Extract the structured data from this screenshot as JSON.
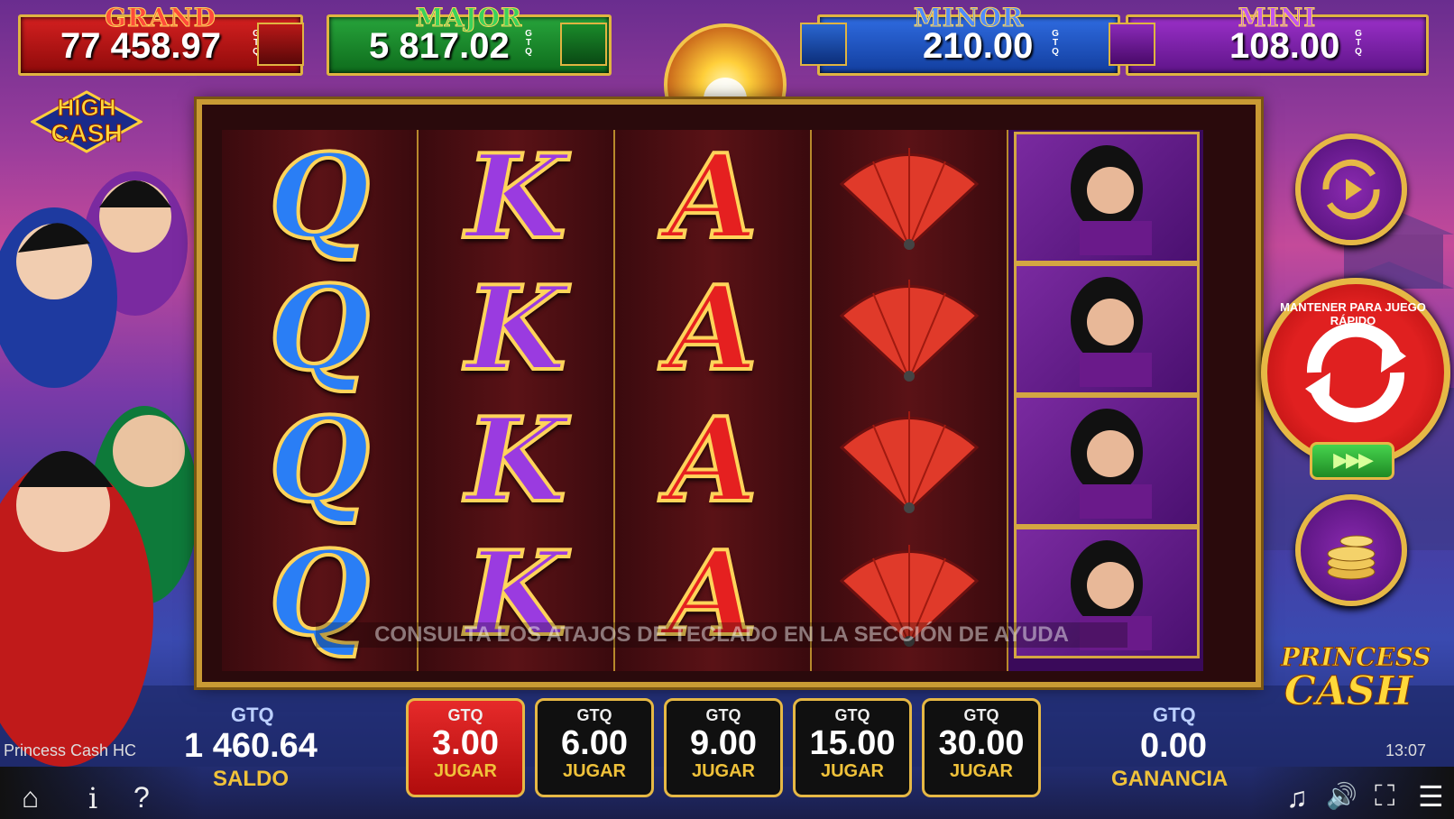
{
  "jackpots": {
    "grand": {
      "title": "GRAND",
      "value": "77 458.97",
      "currency": "GTQ"
    },
    "major": {
      "title": "MAJOR",
      "value": "5 817.02",
      "currency": "GTQ"
    },
    "minor": {
      "title": "MINOR",
      "value": "210.00",
      "currency": "GTQ"
    },
    "mini": {
      "title": "MINI",
      "value": "108.00",
      "currency": "GTQ"
    }
  },
  "logo_high_cash": [
    "HIGH",
    "CASH"
  ],
  "logo_princess_cash": [
    "PRINCESS",
    "CASH"
  ],
  "reels": [
    {
      "symbols": [
        "Q",
        "Q",
        "Q",
        "Q"
      ]
    },
    {
      "symbols": [
        "K",
        "K",
        "K",
        "K"
      ]
    },
    {
      "symbols": [
        "A",
        "A",
        "A",
        "A"
      ]
    },
    {
      "symbols": [
        "fan",
        "fan",
        "fan",
        "fan"
      ]
    },
    {
      "symbols": [
        "princess",
        "princess",
        "princess",
        "princess"
      ]
    }
  ],
  "hint": "CONSULTA LOS ATAJOS DE TECLADO EN LA SECCIÓN DE AYUDA",
  "spin_button_text": "MANTENER PARA JUEGO RÁPIDO",
  "turbo_label": "▶▶▶",
  "balance": {
    "currency": "GTQ",
    "value": "1 460.64",
    "label": "SALDO"
  },
  "win": {
    "currency": "GTQ",
    "value": "0.00",
    "label": "GANANCIA"
  },
  "bets": [
    {
      "currency": "GTQ",
      "value": "3.00",
      "label": "JUGAR",
      "active": true
    },
    {
      "currency": "GTQ",
      "value": "6.00",
      "label": "JUGAR",
      "active": false
    },
    {
      "currency": "GTQ",
      "value": "9.00",
      "label": "JUGAR",
      "active": false
    },
    {
      "currency": "GTQ",
      "value": "15.00",
      "label": "JUGAR",
      "active": false
    },
    {
      "currency": "GTQ",
      "value": "30.00",
      "label": "JUGAR",
      "active": false
    }
  ],
  "game_name": "Princess Cash HC",
  "clock": "13:07",
  "icons": {
    "home": "⌂",
    "info": "i",
    "help": "?",
    "music": "♫",
    "sound": "🔊",
    "fullscreen": "⛶",
    "menu": "☰"
  },
  "colors": {
    "gold": "#e6b845",
    "active_bet": "#e62a2a"
  }
}
